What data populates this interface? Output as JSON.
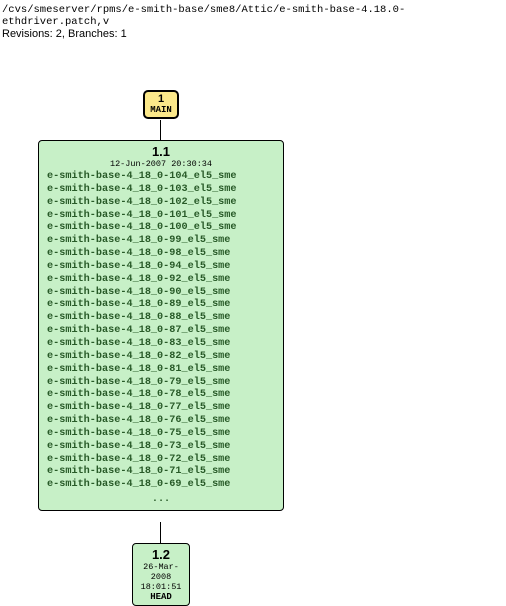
{
  "header": {
    "path": "/cvs/smeserver/rpms/e-smith-base/sme8/Attic/e-smith-base-4.18.0-ethdriver.patch,v",
    "meta": "Revisions: 2, Branches: 1"
  },
  "main_node": {
    "num": "1",
    "label": "MAIN"
  },
  "rev11": {
    "title": "1.1",
    "date": "12-Jun-2007 20:30:34",
    "tags": [
      "e-smith-base-4_18_0-104_el5_sme",
      "e-smith-base-4_18_0-103_el5_sme",
      "e-smith-base-4_18_0-102_el5_sme",
      "e-smith-base-4_18_0-101_el5_sme",
      "e-smith-base-4_18_0-100_el5_sme",
      "e-smith-base-4_18_0-99_el5_sme",
      "e-smith-base-4_18_0-98_el5_sme",
      "e-smith-base-4_18_0-94_el5_sme",
      "e-smith-base-4_18_0-92_el5_sme",
      "e-smith-base-4_18_0-90_el5_sme",
      "e-smith-base-4_18_0-89_el5_sme",
      "e-smith-base-4_18_0-88_el5_sme",
      "e-smith-base-4_18_0-87_el5_sme",
      "e-smith-base-4_18_0-83_el5_sme",
      "e-smith-base-4_18_0-82_el5_sme",
      "e-smith-base-4_18_0-81_el5_sme",
      "e-smith-base-4_18_0-79_el5_sme",
      "e-smith-base-4_18_0-78_el5_sme",
      "e-smith-base-4_18_0-77_el5_sme",
      "e-smith-base-4_18_0-76_el5_sme",
      "e-smith-base-4_18_0-75_el5_sme",
      "e-smith-base-4_18_0-73_el5_sme",
      "e-smith-base-4_18_0-72_el5_sme",
      "e-smith-base-4_18_0-71_el5_sme",
      "e-smith-base-4_18_0-69_el5_sme"
    ],
    "ellipsis": "..."
  },
  "rev12": {
    "title": "1.2",
    "date": "26-Mar-2008 18:01:51",
    "head": "HEAD"
  }
}
